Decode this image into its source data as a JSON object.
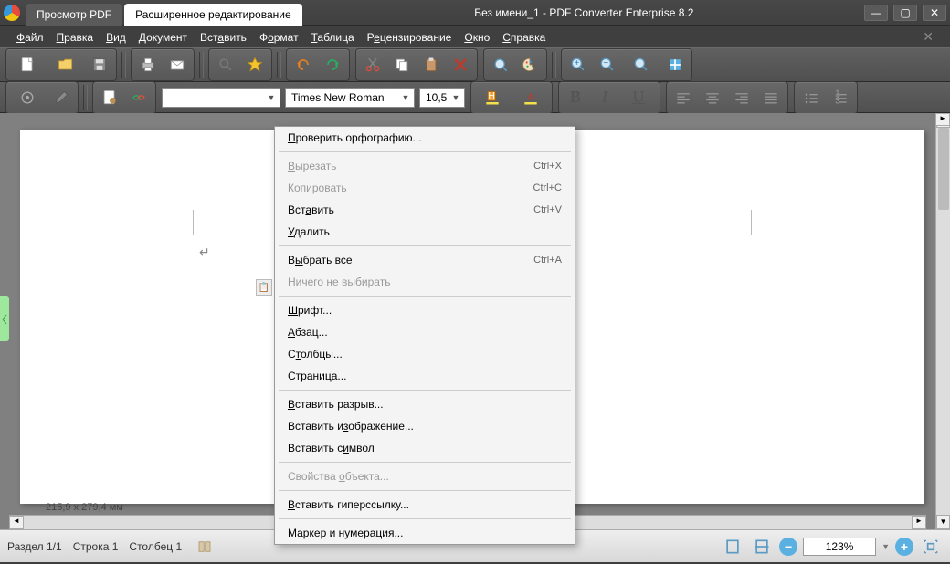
{
  "titlebar": {
    "tabs": [
      {
        "label": "Просмотр PDF",
        "active": false
      },
      {
        "label": "Расширенное редактирование",
        "active": true
      }
    ],
    "title": "Без имени_1 - PDF Converter Enterprise 8.2"
  },
  "menubar": [
    {
      "html": "<u>Ф</u>айл"
    },
    {
      "html": "<u>П</u>равка"
    },
    {
      "html": "<u>В</u>ид"
    },
    {
      "html": "<u>Д</u>окумент"
    },
    {
      "html": "Вст<u>а</u>вить"
    },
    {
      "html": "Ф<u>о</u>рмат"
    },
    {
      "html": "<u>Т</u>аблица"
    },
    {
      "html": "Р<u>е</u>цензирование"
    },
    {
      "html": "<u>О</u>кно"
    },
    {
      "html": "<u>С</u>правка"
    }
  ],
  "toolbar2": {
    "font": "Times New Roman",
    "size": "10,5"
  },
  "ruler_info": "215,9 x 279,4 мм",
  "statusbar": {
    "section": "Раздел 1/1",
    "row": "Строка 1",
    "column": "Столбец 1",
    "zoom": "123%"
  },
  "context_menu": [
    {
      "type": "item",
      "label": "<u>П</u>роверить орфографию...",
      "enabled": true
    },
    {
      "type": "sep"
    },
    {
      "type": "item",
      "label": "<u>В</u>ырезать",
      "shortcut": "Ctrl+X",
      "enabled": false
    },
    {
      "type": "item",
      "label": "<u>К</u>опировать",
      "shortcut": "Ctrl+C",
      "enabled": false
    },
    {
      "type": "item",
      "label": "Вст<u>а</u>вить",
      "shortcut": "Ctrl+V",
      "enabled": true
    },
    {
      "type": "item",
      "label": "<u>У</u>далить",
      "enabled": true
    },
    {
      "type": "sep"
    },
    {
      "type": "item",
      "label": "В<u>ы</u>брать все",
      "shortcut": "Ctrl+A",
      "enabled": true
    },
    {
      "type": "item",
      "label": "Ничего не выбирать",
      "enabled": false
    },
    {
      "type": "sep"
    },
    {
      "type": "item",
      "label": "<u>Ш</u>рифт...",
      "enabled": true
    },
    {
      "type": "item",
      "label": "<u>А</u>бзац...",
      "enabled": true
    },
    {
      "type": "item",
      "label": "С<u>т</u>олбцы...",
      "enabled": true
    },
    {
      "type": "item",
      "label": "Стра<u>н</u>ица...",
      "enabled": true
    },
    {
      "type": "sep"
    },
    {
      "type": "item",
      "label": "<u>В</u>ставить разрыв...",
      "enabled": true
    },
    {
      "type": "item",
      "label": "Вставить и<u>з</u>ображение...",
      "enabled": true
    },
    {
      "type": "item",
      "label": "Вставить с<u>и</u>мвол",
      "enabled": true
    },
    {
      "type": "sep"
    },
    {
      "type": "item",
      "label": "Свойства <u>о</u>бъекта...",
      "enabled": false
    },
    {
      "type": "sep"
    },
    {
      "type": "item",
      "label": "<u>В</u>ставить гиперссылку...",
      "enabled": true
    },
    {
      "type": "sep"
    },
    {
      "type": "item",
      "label": "Марк<u>е</u>р и нумерация...",
      "enabled": true
    }
  ]
}
